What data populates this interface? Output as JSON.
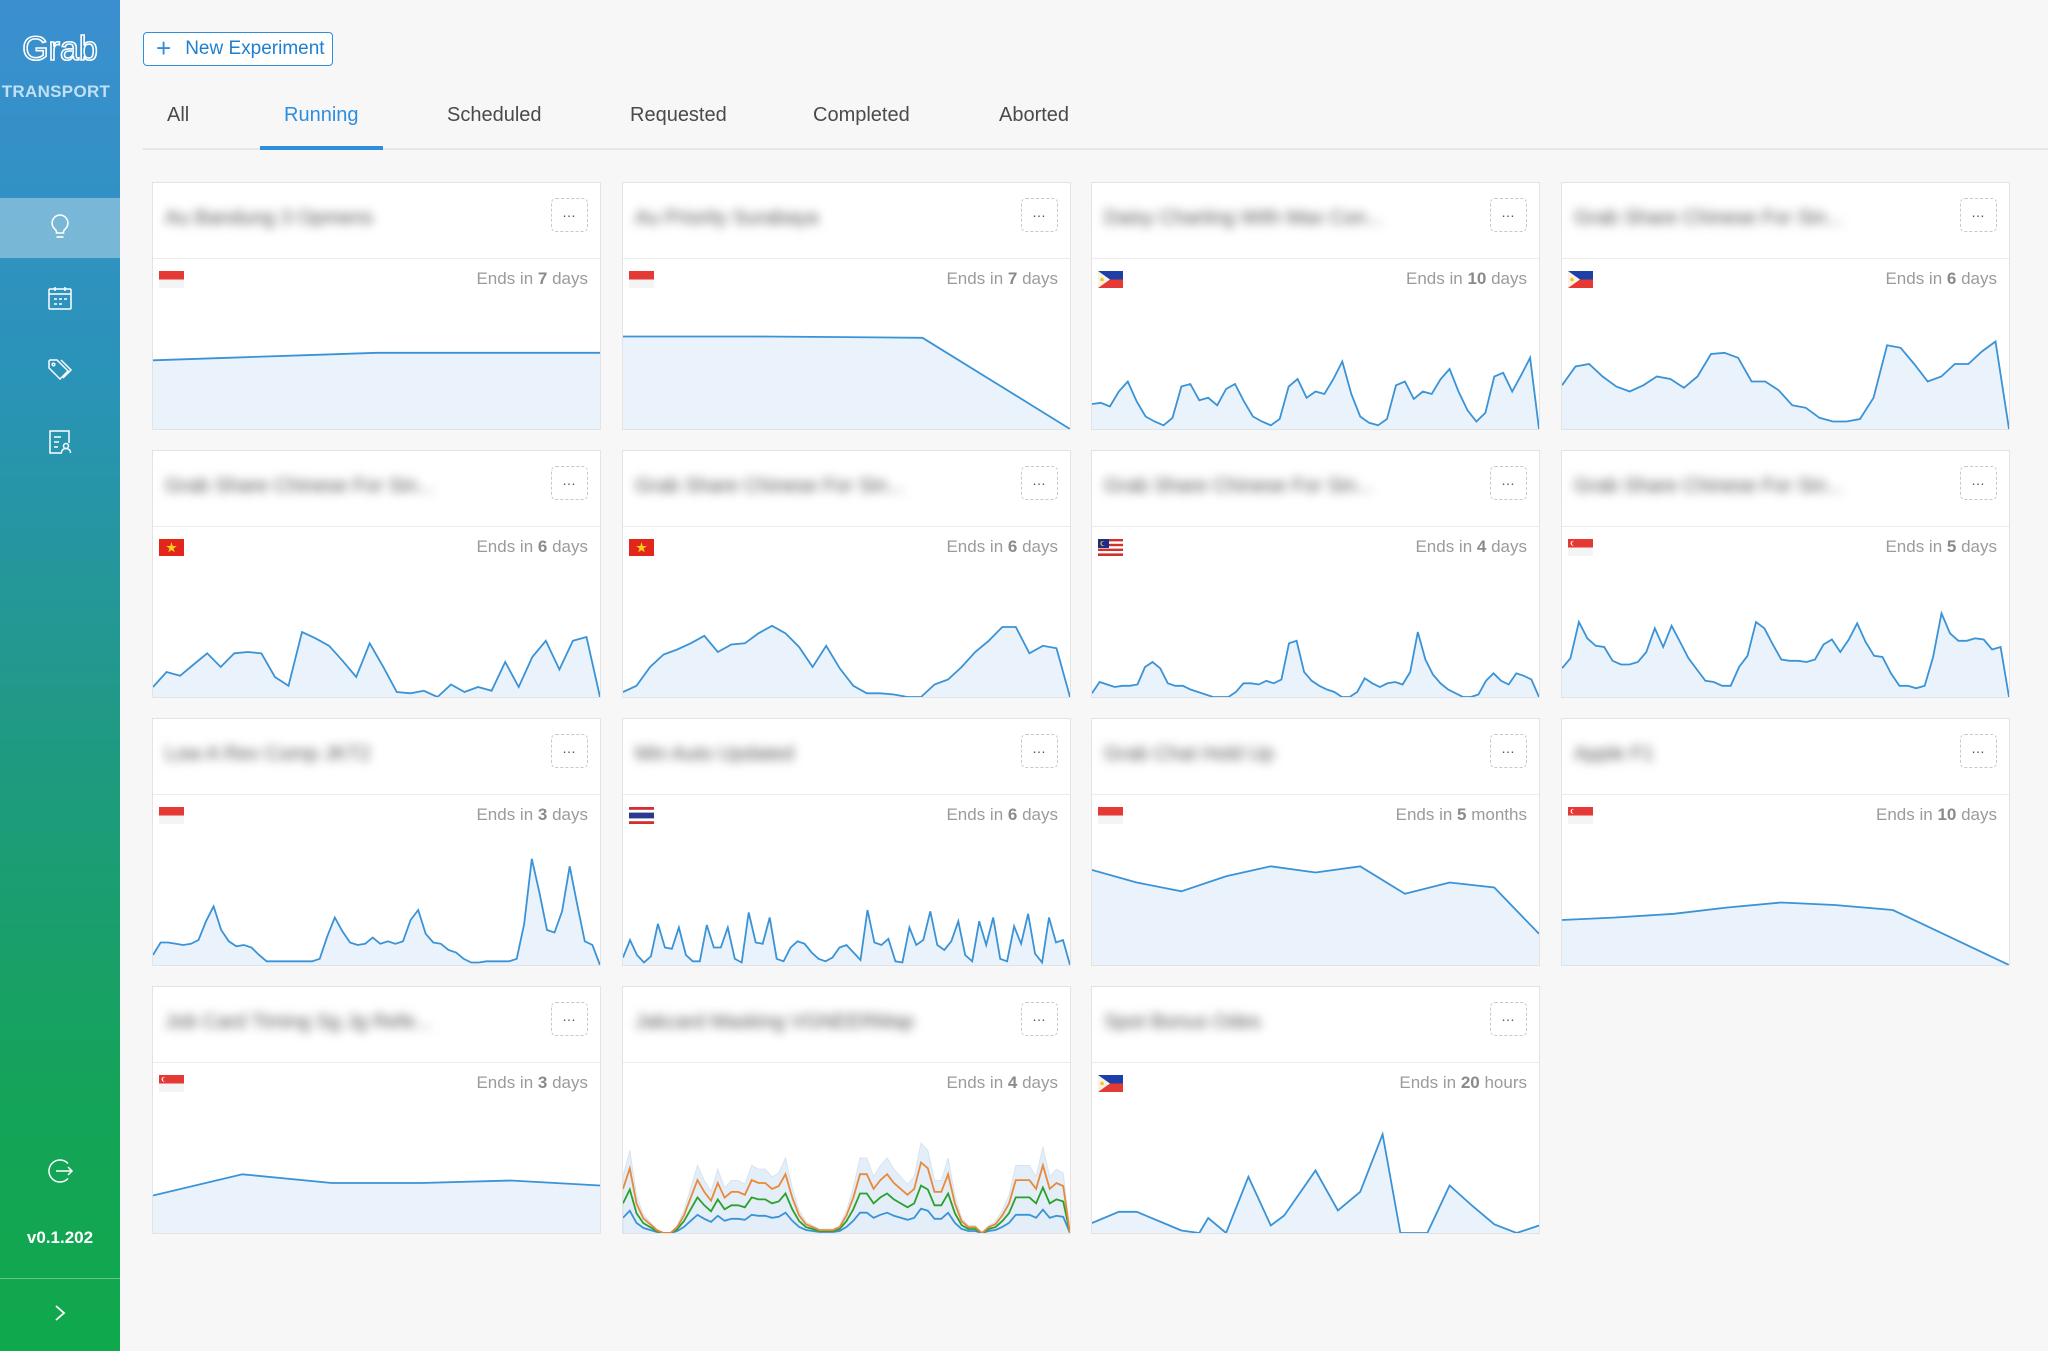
{
  "app": {
    "brand": "Grab",
    "brand_sub": "TRANSPORT",
    "version": "v0.1.202"
  },
  "sidebar": {
    "items": [
      {
        "name": "experiments",
        "icon": "lightbulb-icon",
        "active": true
      },
      {
        "name": "calendar",
        "icon": "calendar-icon",
        "active": false
      },
      {
        "name": "tags",
        "icon": "tags-icon",
        "active": false
      },
      {
        "name": "reports",
        "icon": "user-report-icon",
        "active": false
      }
    ],
    "logout_icon": "logout-icon",
    "expand_icon": "chevron-right-icon"
  },
  "header": {
    "new_button": "New Experiment",
    "tabs": [
      {
        "label": "All",
        "active": false
      },
      {
        "label": "Running",
        "active": true
      },
      {
        "label": "Scheduled",
        "active": false
      },
      {
        "label": "Requested",
        "active": false
      },
      {
        "label": "Completed",
        "active": false
      },
      {
        "label": "Aborted",
        "active": false
      }
    ]
  },
  "colors": {
    "accent": "#2e8ede",
    "line": "#3a93d6",
    "fill": "#eaf3fb",
    "series_orange": "#e8893a",
    "series_green": "#2ca02c"
  },
  "cards": [
    {
      "title": "Au Bandung 3 Opmens",
      "country": "ID",
      "ends_prefix": "Ends in",
      "ends_value": "7",
      "ends_unit": "days",
      "series": [
        [
          0.55,
          0.57,
          0.59,
          0.61,
          0.61,
          0.61,
          0.61
        ]
      ]
    },
    {
      "title": "Au Priority Surabaya",
      "country": "ID",
      "ends_prefix": "Ends in",
      "ends_value": "7",
      "ends_unit": "days",
      "series": [
        [
          0.74,
          0.74,
          0.735,
          0.73,
          0.0
        ]
      ],
      "xs": [
        0,
        0.3,
        0.5,
        0.67,
        1
      ]
    },
    {
      "title": "Daisy Charting With Max Con...",
      "country": "PH",
      "ends_prefix": "Ends in",
      "ends_value": "10 days",
      "ends_unit": "",
      "series": [
        [
          0.2,
          0.21,
          0.18,
          0.3,
          0.38,
          0.22,
          0.1,
          0.06,
          0.03,
          0.09,
          0.34,
          0.36,
          0.23,
          0.25,
          0.19,
          0.32,
          0.36,
          0.22,
          0.1,
          0.06,
          0.03,
          0.08,
          0.34,
          0.4,
          0.25,
          0.3,
          0.28,
          0.4,
          0.54,
          0.28,
          0.1,
          0.05,
          0.03,
          0.08,
          0.35,
          0.38,
          0.24,
          0.3,
          0.28,
          0.4,
          0.48,
          0.3,
          0.15,
          0.06,
          0.13,
          0.42,
          0.45,
          0.3,
          0.43,
          0.57,
          0.0
        ]
      ]
    },
    {
      "title": "Grab Share Chinese For Sin...",
      "country": "PH",
      "ends_prefix": "Ends in",
      "ends_value": "6",
      "ends_unit": "days",
      "series": [
        [
          0.35,
          0.5,
          0.52,
          0.42,
          0.34,
          0.3,
          0.35,
          0.42,
          0.4,
          0.33,
          0.42,
          0.6,
          0.61,
          0.57,
          0.38,
          0.38,
          0.31,
          0.19,
          0.17,
          0.09,
          0.06,
          0.06,
          0.08,
          0.25,
          0.67,
          0.65,
          0.52,
          0.38,
          0.42,
          0.52,
          0.52,
          0.62,
          0.7,
          0.0
        ]
      ]
    },
    {
      "title": "Grab Share Chinese For Sin...",
      "country": "VN",
      "ends_prefix": "Ends in",
      "ends_value": "6",
      "ends_unit": "days",
      "series": [
        [
          0.08,
          0.2,
          0.17,
          0.26,
          0.35,
          0.24,
          0.35,
          0.36,
          0.35,
          0.16,
          0.09,
          0.52,
          0.47,
          0.41,
          0.29,
          0.16,
          0.43,
          0.24,
          0.04,
          0.03,
          0.05,
          0.0,
          0.1,
          0.04,
          0.08,
          0.05,
          0.28,
          0.08,
          0.32,
          0.45,
          0.22,
          0.45,
          0.48,
          0.0
        ]
      ]
    },
    {
      "title": "Grab Share Chinese For Sin...",
      "country": "VN",
      "ends_prefix": "Ends in",
      "ends_value": "6",
      "ends_unit": "days",
      "series": [
        [
          0.04,
          0.09,
          0.24,
          0.34,
          0.38,
          0.43,
          0.49,
          0.36,
          0.42,
          0.43,
          0.51,
          0.57,
          0.51,
          0.4,
          0.24,
          0.41,
          0.23,
          0.09,
          0.03,
          0.03,
          0.02,
          0.0,
          0.0,
          0.1,
          0.14,
          0.24,
          0.36,
          0.45,
          0.56,
          0.56,
          0.35,
          0.41,
          0.39,
          0.0
        ]
      ]
    },
    {
      "title": "Grab Share Chinese For Sin...",
      "country": "MY",
      "ends_prefix": "Ends in",
      "ends_value": "4",
      "ends_unit": "days",
      "series": [
        [
          0.03,
          0.12,
          0.1,
          0.08,
          0.09,
          0.09,
          0.1,
          0.24,
          0.28,
          0.23,
          0.11,
          0.09,
          0.09,
          0.06,
          0.04,
          0.02,
          0.0,
          0.0,
          0.0,
          0.04,
          0.11,
          0.11,
          0.1,
          0.13,
          0.11,
          0.14,
          0.43,
          0.45,
          0.2,
          0.13,
          0.09,
          0.06,
          0.04,
          0.0,
          0.0,
          0.04,
          0.15,
          0.11,
          0.08,
          0.11,
          0.12,
          0.1,
          0.2,
          0.52,
          0.3,
          0.18,
          0.11,
          0.06,
          0.03,
          0.0,
          0.0,
          0.02,
          0.13,
          0.19,
          0.13,
          0.1,
          0.19,
          0.17,
          0.14,
          0.0
        ]
      ]
    },
    {
      "title": "Grab Share Chinese For Sin...",
      "country": "SG",
      "ends_prefix": "Ends in",
      "ends_value": "5",
      "ends_unit": "days",
      "series": [
        [
          0.23,
          0.31,
          0.6,
          0.47,
          0.41,
          0.4,
          0.29,
          0.26,
          0.26,
          0.28,
          0.36,
          0.55,
          0.4,
          0.57,
          0.44,
          0.31,
          0.22,
          0.13,
          0.12,
          0.09,
          0.09,
          0.24,
          0.33,
          0.6,
          0.55,
          0.42,
          0.3,
          0.29,
          0.29,
          0.28,
          0.3,
          0.42,
          0.46,
          0.36,
          0.46,
          0.59,
          0.44,
          0.33,
          0.32,
          0.19,
          0.09,
          0.09,
          0.07,
          0.09,
          0.32,
          0.67,
          0.51,
          0.45,
          0.45,
          0.47,
          0.46,
          0.38,
          0.4,
          0.0
        ]
      ]
    },
    {
      "title": "Low A Rev Comp JKT2",
      "country": "ID",
      "ends_prefix": "Ends in",
      "ends_value": "3",
      "ends_unit": "days",
      "series": [
        [
          0.08,
          0.18,
          0.18,
          0.17,
          0.16,
          0.17,
          0.2,
          0.35,
          0.47,
          0.28,
          0.19,
          0.15,
          0.16,
          0.14,
          0.08,
          0.03,
          0.03,
          0.03,
          0.03,
          0.03,
          0.03,
          0.03,
          0.05,
          0.23,
          0.38,
          0.27,
          0.18,
          0.16,
          0.17,
          0.22,
          0.17,
          0.19,
          0.17,
          0.19,
          0.36,
          0.44,
          0.25,
          0.18,
          0.17,
          0.12,
          0.1,
          0.05,
          0.02,
          0.02,
          0.03,
          0.03,
          0.03,
          0.03,
          0.05,
          0.33,
          0.85,
          0.58,
          0.28,
          0.26,
          0.43,
          0.79,
          0.48,
          0.19,
          0.16,
          0.0
        ]
      ]
    },
    {
      "title": "Min Auto Updated",
      "country": "TH",
      "ends_prefix": "Ends in",
      "ends_value": "6",
      "ends_unit": "days",
      "series": [
        [
          0.06,
          0.2,
          0.08,
          0.02,
          0.07,
          0.33,
          0.14,
          0.13,
          0.3,
          0.08,
          0.03,
          0.03,
          0.32,
          0.14,
          0.14,
          0.3,
          0.05,
          0.02,
          0.42,
          0.18,
          0.17,
          0.38,
          0.05,
          0.03,
          0.14,
          0.19,
          0.17,
          0.1,
          0.05,
          0.03,
          0.06,
          0.14,
          0.16,
          0.1,
          0.04,
          0.44,
          0.18,
          0.16,
          0.21,
          0.03,
          0.02,
          0.3,
          0.16,
          0.2,
          0.43,
          0.16,
          0.12,
          0.19,
          0.35,
          0.08,
          0.03,
          0.35,
          0.16,
          0.38,
          0.05,
          0.03,
          0.31,
          0.17,
          0.41,
          0.09,
          0.02,
          0.38,
          0.18,
          0.2,
          0.0
        ]
      ]
    },
    {
      "title": "Grab Chat Hold Up",
      "country": "ID",
      "ends_prefix": "Ends in",
      "ends_value": "5",
      "ends_unit": "months",
      "series": [
        [
          0.76,
          0.66,
          0.59,
          0.71,
          0.79,
          0.74,
          0.79,
          0.57,
          0.66,
          0.62,
          0.25
        ]
      ]
    },
    {
      "title": "Apple F1",
      "country": "SG",
      "ends_prefix": "Ends in",
      "ends_value": "10",
      "ends_unit": "days",
      "series": [
        [
          0.36,
          0.38,
          0.41,
          0.46,
          0.5,
          0.48,
          0.44,
          0.0
        ]
      ],
      "xs": [
        0,
        0.12,
        0.25,
        0.37,
        0.49,
        0.61,
        0.74,
        1
      ]
    },
    {
      "title": "Job Card Timing Sg Jg Refe...",
      "country": "SG",
      "ends_prefix": "Ends in",
      "ends_value": "3",
      "ends_unit": "days",
      "series": [
        [
          0.3,
          0.47,
          0.4,
          0.4,
          0.42,
          0.38
        ]
      ],
      "xs": [
        0,
        0.2,
        0.4,
        0.6,
        0.8,
        1
      ]
    },
    {
      "title": "Jakcard Masking VGNEERMap",
      "country": "",
      "ends_prefix": "Ends in",
      "ends_value": "4",
      "ends_unit": "days",
      "multi": true,
      "base": [
        0.15,
        0.22,
        0.1,
        0.05,
        0.03,
        0.01,
        0.0,
        0.0,
        0.02,
        0.06,
        0.12,
        0.18,
        0.14,
        0.11,
        0.17,
        0.12,
        0.14,
        0.14,
        0.13,
        0.18,
        0.17,
        0.17,
        0.15,
        0.16,
        0.2,
        0.12,
        0.06,
        0.03,
        0.02,
        0.01,
        0.01,
        0.01,
        0.02,
        0.06,
        0.12,
        0.2,
        0.2,
        0.15,
        0.18,
        0.2,
        0.17,
        0.15,
        0.13,
        0.15,
        0.24,
        0.22,
        0.14,
        0.14,
        0.2,
        0.1,
        0.04,
        0.02,
        0.02,
        0.0,
        0.02,
        0.03,
        0.06,
        0.1,
        0.18,
        0.18,
        0.18,
        0.15,
        0.23,
        0.15,
        0.17,
        0.16,
        0.0
      ],
      "series_scale": [
        1.0,
        1.95,
        2.9,
        3.7
      ]
    },
    {
      "title": "Spot Bonus Odes",
      "country": "PH",
      "ends_prefix": "Ends in",
      "ends_value": "20",
      "ends_unit": "hours",
      "series": [
        [
          0.08,
          0.17,
          0.17,
          0.08,
          0.02,
          0.0,
          0.12,
          0.0,
          0.45,
          0.06,
          0.14,
          0.5,
          0.18,
          0.33,
          0.79,
          0.0,
          0.0,
          0.38,
          0.22,
          0.07,
          0.0,
          0.06
        ]
      ],
      "xs": [
        0,
        0.06,
        0.1,
        0.16,
        0.2,
        0.24,
        0.26,
        0.3,
        0.35,
        0.4,
        0.43,
        0.5,
        0.55,
        0.6,
        0.65,
        0.69,
        0.75,
        0.8,
        0.85,
        0.9,
        0.95,
        1
      ]
    }
  ]
}
